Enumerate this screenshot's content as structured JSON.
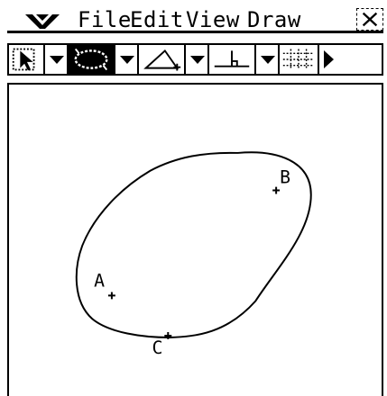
{
  "menubar": {
    "logo_icon": "casio-wing-logo",
    "items": [
      "File",
      "Edit",
      "View",
      "Draw"
    ],
    "close_icon": "close-x-icon"
  },
  "toolbar": {
    "buttons": [
      {
        "icon": "select-arrow-icon"
      },
      {
        "icon": "ellipse-tool-icon",
        "selected": true
      },
      {
        "icon": "triangle-tool-icon"
      },
      {
        "icon": "perpendicular-tool-icon"
      },
      {
        "icon": "grid-tool-icon"
      },
      {
        "icon": "scroll-right-icon"
      }
    ]
  },
  "canvas": {
    "points": [
      {
        "label": "A"
      },
      {
        "label": "B"
      },
      {
        "label": "C"
      }
    ]
  }
}
